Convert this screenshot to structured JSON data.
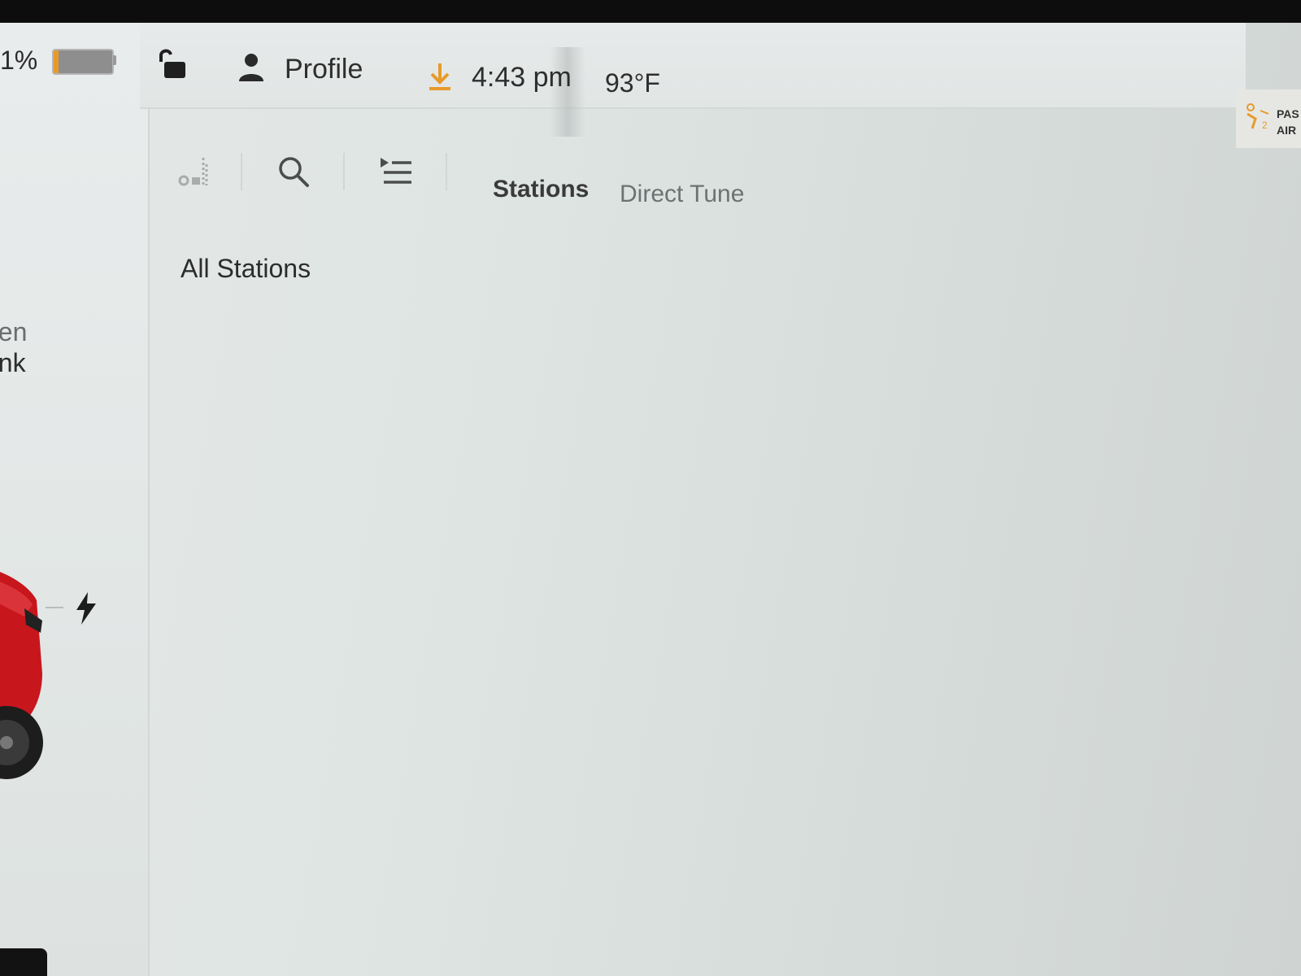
{
  "car_panel": {
    "battery_percent_label": "1%",
    "battery_level": 0.01,
    "trunk_line1": "pen",
    "trunk_line2": "unk",
    "car_color": "#c8161d"
  },
  "status_bar": {
    "profile_label": "Profile",
    "time": "4:43 pm",
    "temperature": "93°F",
    "airbag_line1": "PAS",
    "airbag_line2": "AIR",
    "accent_color": "#e79a2a"
  },
  "media": {
    "tabs": [
      {
        "label": "Stations",
        "active": true
      },
      {
        "label": "Direct Tune",
        "active": false
      }
    ],
    "section_title": "All Stations",
    "stations": []
  }
}
